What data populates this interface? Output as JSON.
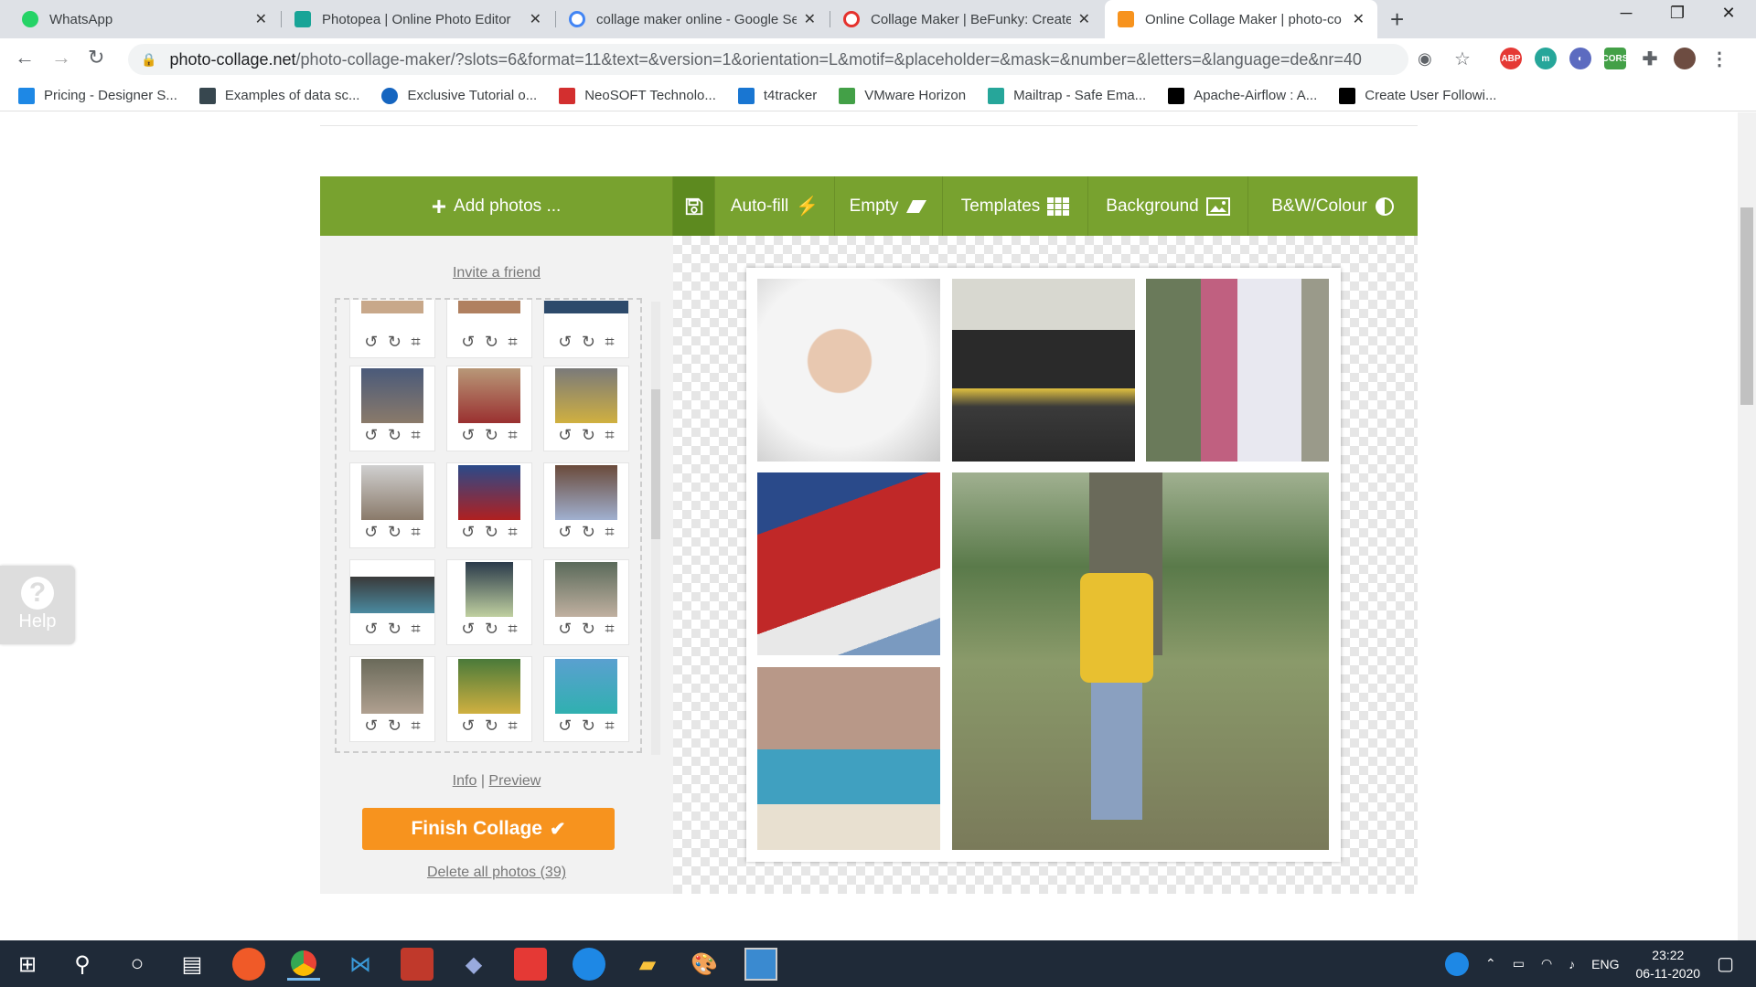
{
  "tabs": [
    {
      "label": "WhatsApp",
      "color": "#25d366"
    },
    {
      "label": "Photopea | Online Photo Editor",
      "color": "#18a497"
    },
    {
      "label": "collage maker online - Google Se",
      "color": "#4285f4"
    },
    {
      "label": "Collage Maker | BeFunky: Create",
      "color": "#e5322d"
    },
    {
      "label": "Online Collage Maker | photo-co",
      "color": "#f7931e"
    }
  ],
  "url": {
    "domain": "photo-collage.net",
    "path": "/photo-collage-maker/?slots=6&format=11&text=&version=1&orientation=L&motif=&placeholder=&mask=&number=&letters=&language=de&nr=40"
  },
  "bookmarks": [
    {
      "label": "Pricing - Designer S...",
      "color": "#1e88e5"
    },
    {
      "label": "Examples of data sc...",
      "color": "#37474f"
    },
    {
      "label": "Exclusive Tutorial o...",
      "color": "#1565c0"
    },
    {
      "label": "NeoSOFT Technolo...",
      "color": "#d32f2f"
    },
    {
      "label": "t4tracker",
      "color": "#1976d2"
    },
    {
      "label": "VMware Horizon",
      "color": "#43a047"
    },
    {
      "label": "Mailtrap - Safe Ema...",
      "color": "#26a69a"
    },
    {
      "label": "Apache-Airflow : A...",
      "color": "#000000"
    },
    {
      "label": "Create User Followi...",
      "color": "#000000"
    }
  ],
  "toolbar": {
    "add_photos": "Add photos ...",
    "autofill": "Auto-fill",
    "empty": "Empty",
    "templates": "Templates",
    "background": "Background",
    "bw_colour": "B&W/Colour"
  },
  "left_panel": {
    "invite": "Invite a friend",
    "info": "Info",
    "sep": "|",
    "preview": "Preview",
    "finish": "Finish Collage",
    "delete_all": "Delete all photos (39)"
  },
  "help": {
    "label": "Help"
  },
  "taskbar": {
    "lang": "ENG",
    "time": "23:22",
    "date": "06-11-2020"
  },
  "theme": {
    "accent": "#78a22f",
    "finish": "#f7931e"
  }
}
